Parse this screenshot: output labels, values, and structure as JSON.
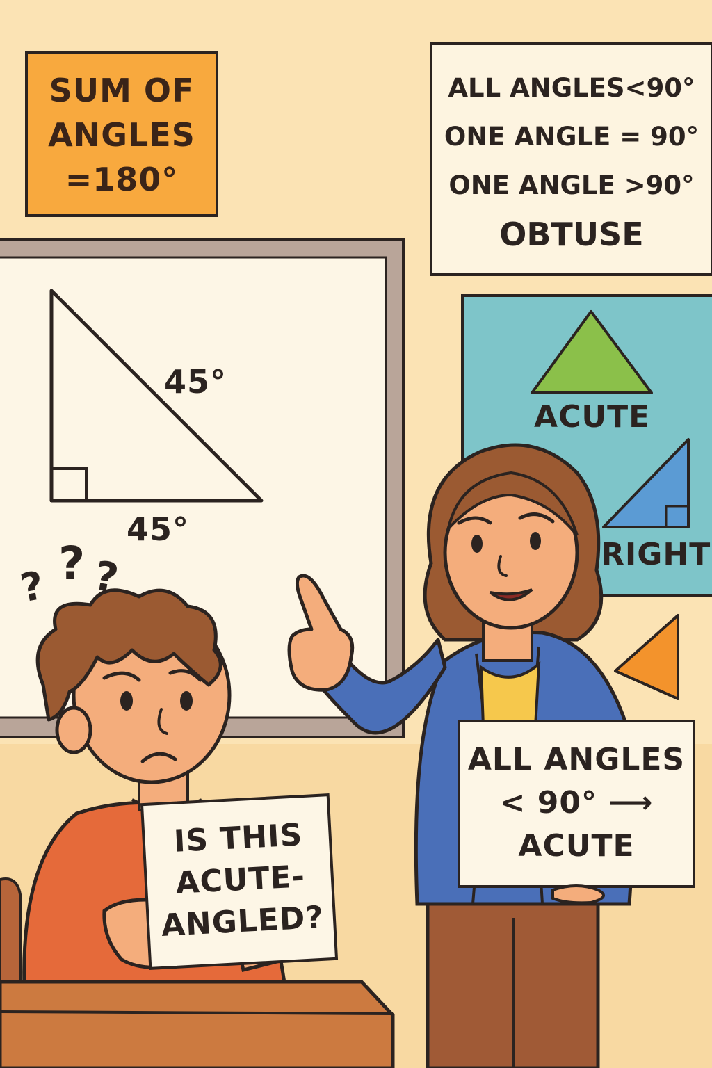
{
  "colors": {
    "wall": "#fbe3b4",
    "sum_sign": "#f8a93e",
    "poster": "#7ec5c9",
    "acute_triangle": "#8bc04a",
    "right_triangle": "#5b9bd4",
    "obtuse_triangle": "#f3932c",
    "teacher_jacket": "#4a6fb8",
    "student_shirt": "#e56a3a",
    "desk": "#cc7a40",
    "outline": "#2b2320"
  },
  "sum_sign": {
    "line1": "SUM OF",
    "line2": "ANGLES",
    "line3": "=180°"
  },
  "types_sign": {
    "line1": "ALL ANGLES<90°",
    "line2": "ONE ANGLE = 90°",
    "line3": "ONE ANGLE >90°",
    "line4": "OBTUSE"
  },
  "whiteboard": {
    "angle_top": "45°",
    "angle_bottom": "45°"
  },
  "poster": {
    "acute_label": "ACUTE",
    "right_label": "RIGHT"
  },
  "student": {
    "thought": "?",
    "card_line1": "IS THIS",
    "card_line2": "ACUTE-",
    "card_line3": "ANGLED?"
  },
  "teacher": {
    "card_line1": "ALL ANGLES",
    "card_line2": "< 90° ⟶",
    "card_line3": "ACUTE"
  }
}
